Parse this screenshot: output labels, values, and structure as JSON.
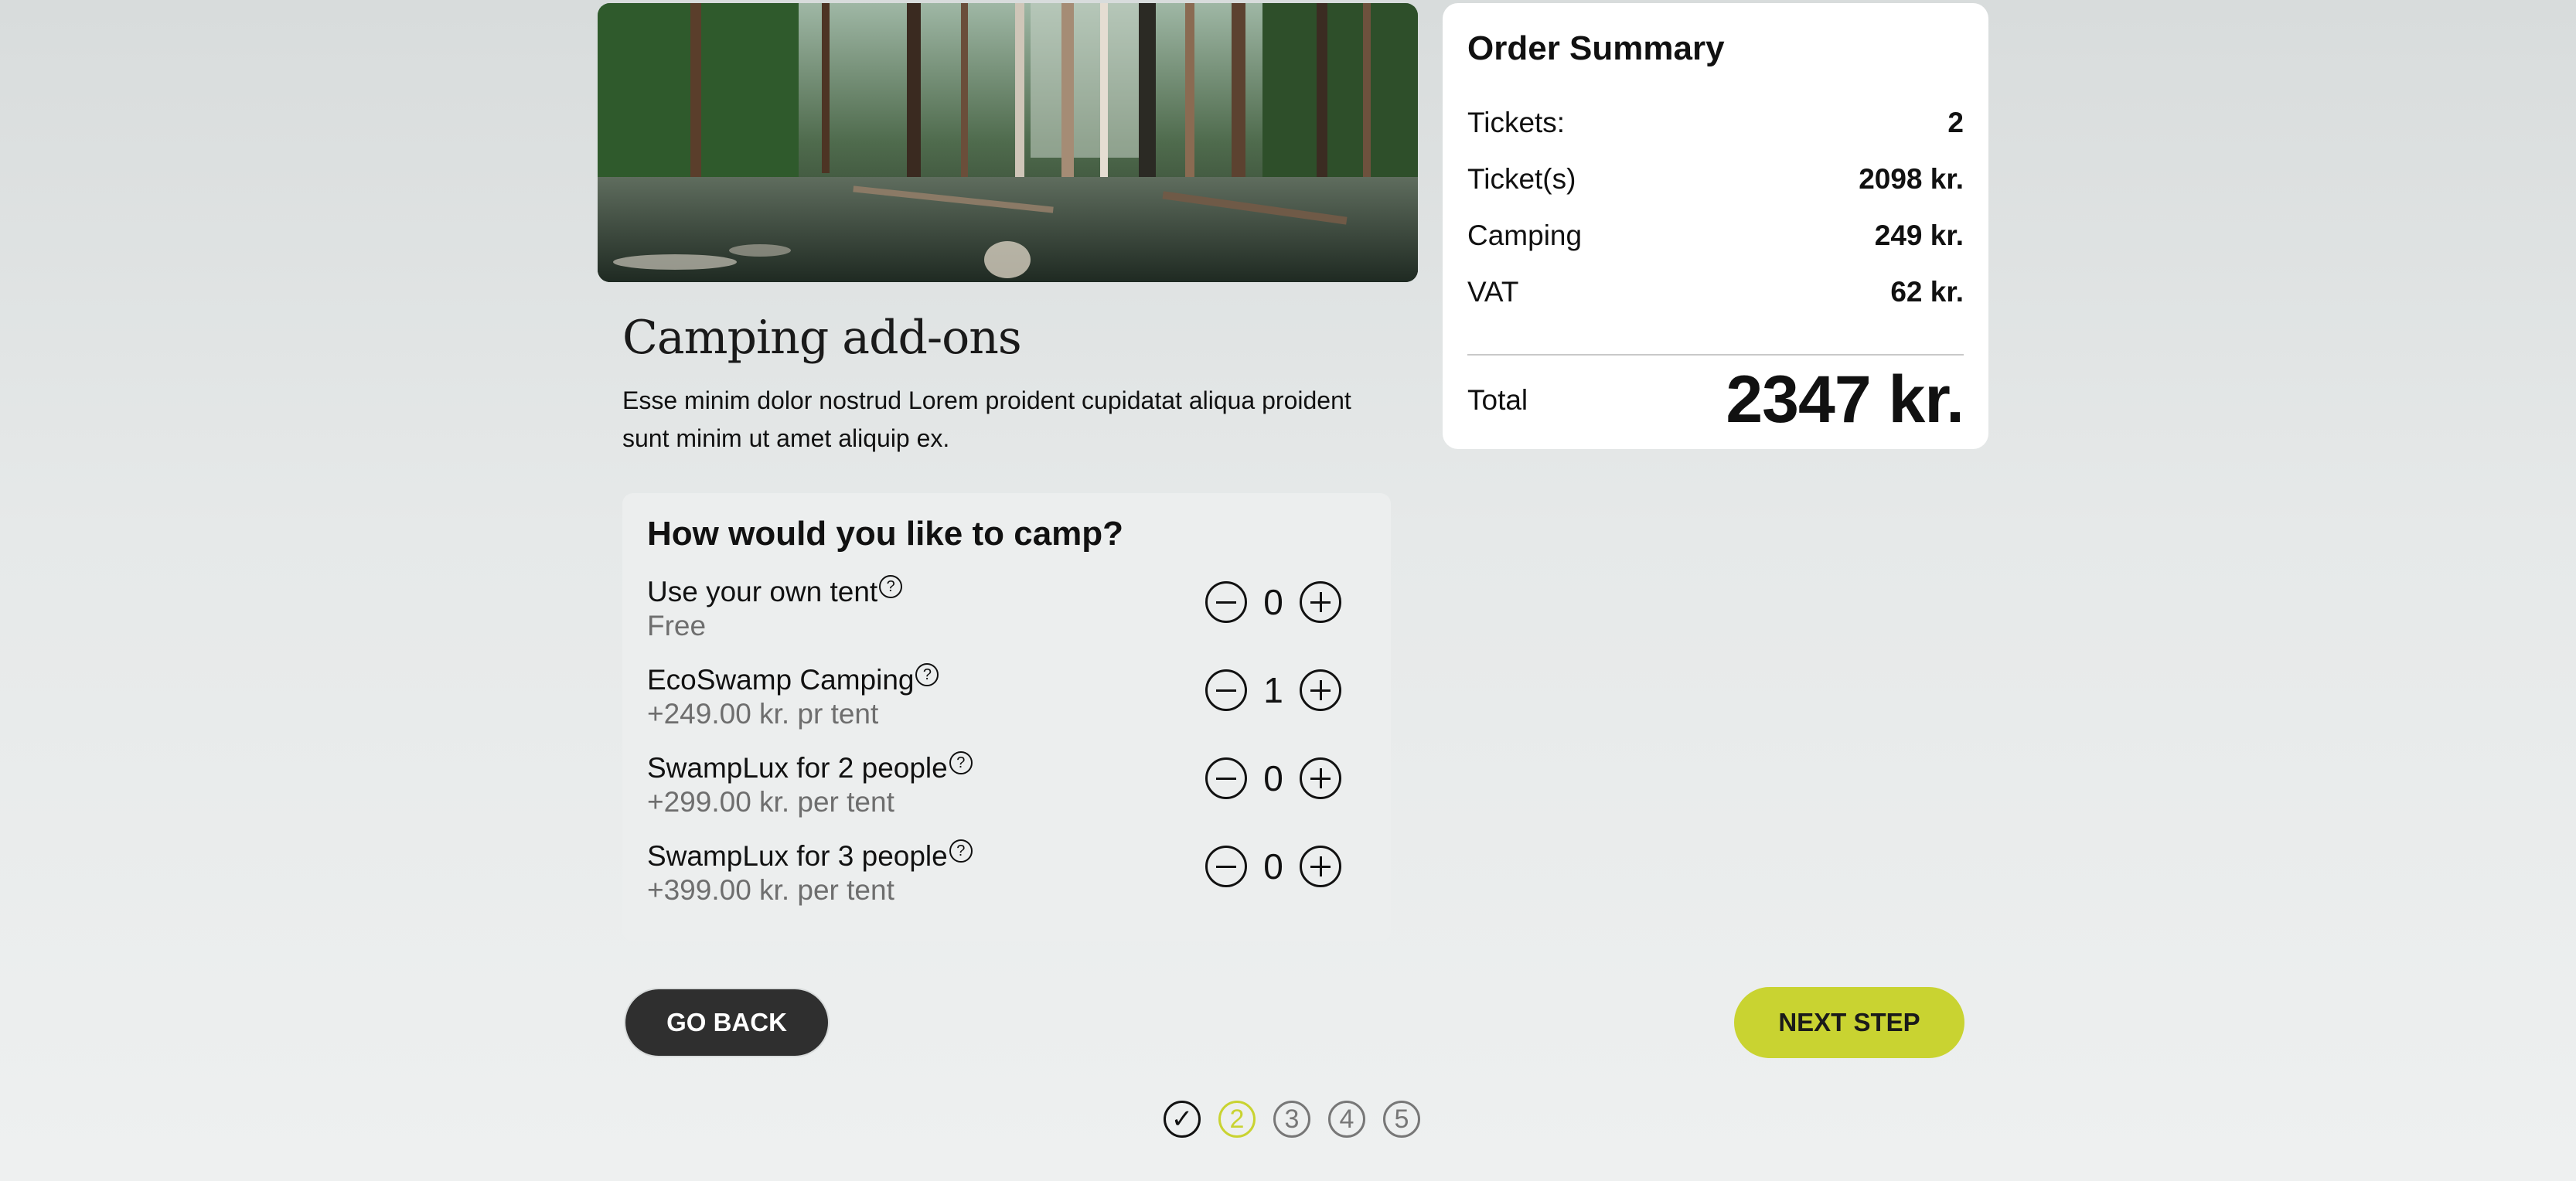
{
  "summary": {
    "title": "Order Summary",
    "rows": [
      {
        "label": "Tickets:",
        "value": "2"
      },
      {
        "label": "Ticket(s)",
        "value": "2098 kr."
      },
      {
        "label": "Camping",
        "value": "249 kr."
      },
      {
        "label": "VAT",
        "value": "62 kr."
      }
    ],
    "total_label": "Total",
    "total_value": "2347 kr."
  },
  "page": {
    "title": "Camping add-ons",
    "description": "Esse minim dolor nostrud Lorem proident cupidatat aliqua proident sunt minim ut amet aliquip ex."
  },
  "camp": {
    "heading": "How would you like to camp?",
    "help_glyph": "?",
    "options": [
      {
        "name": "Use your own tent",
        "price": "Free",
        "qty": "0"
      },
      {
        "name": "EcoSwamp Camping",
        "price": "+249.00 kr. pr tent",
        "qty": "1"
      },
      {
        "name": "SwampLux for 2 people",
        "price": "+299.00 kr. per tent",
        "qty": "0"
      },
      {
        "name": "SwampLux for 3 people",
        "price": "+399.00 kr. per tent",
        "qty": "0"
      }
    ]
  },
  "nav": {
    "back_label": "GO BACK",
    "next_label": "NEXT STEP"
  },
  "progress": {
    "current_step": 2,
    "steps": [
      "✓",
      "2",
      "3",
      "4",
      "5"
    ]
  },
  "colors": {
    "accent": "#c9d331",
    "dark_button": "#2f2f2f",
    "muted_text": "#6e6e6e"
  },
  "icons": {
    "help": "help-circle-icon",
    "minus": "minus-circle-icon",
    "plus": "plus-circle-icon",
    "check": "check-icon"
  }
}
